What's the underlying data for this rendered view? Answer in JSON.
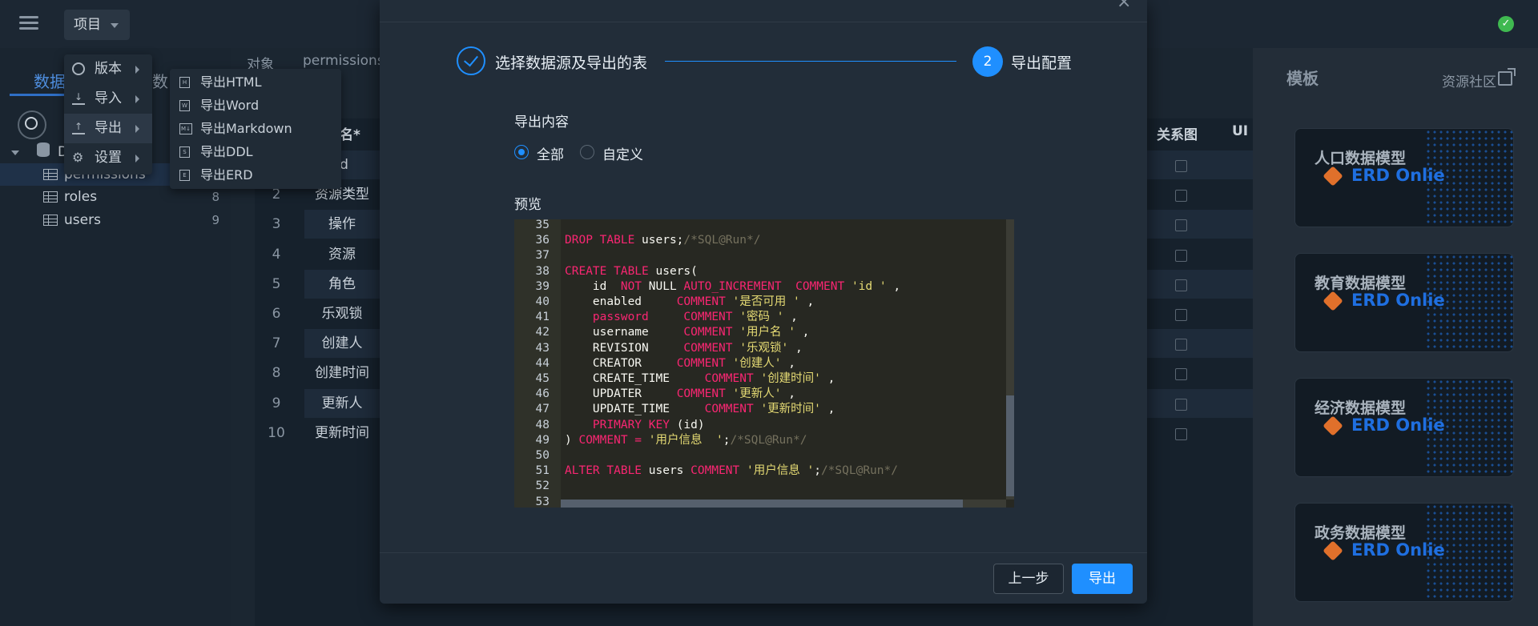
{
  "topbar": {
    "project_label": "项目"
  },
  "left_panel": {
    "tab_data": "数据",
    "tab_second": "数",
    "tree": {
      "db_label": "D",
      "tables": [
        {
          "name": "permissions",
          "count": ""
        },
        {
          "name": "roles",
          "count": "8"
        },
        {
          "name": "users",
          "count": "9"
        }
      ]
    }
  },
  "menu": {
    "items": [
      {
        "label": "版本"
      },
      {
        "label": "导入"
      },
      {
        "label": "导出"
      },
      {
        "label": "设置"
      }
    ],
    "submenu": [
      {
        "label": "导出HTML",
        "icon": "html-file-icon"
      },
      {
        "label": "导出Word",
        "icon": "word-file-icon"
      },
      {
        "label": "导出Markdown",
        "icon": "markdown-icon"
      },
      {
        "label": "导出DDL",
        "icon": "ddl-file-icon"
      },
      {
        "label": "导出ERD",
        "icon": "erd-file-icon"
      }
    ]
  },
  "middle": {
    "tabs": [
      "对象",
      "permissions"
    ],
    "column_header": "名*",
    "col_relation": "关系图",
    "col_ui": "UI",
    "rows": [
      {
        "num": "1",
        "name": "Id"
      },
      {
        "num": "2",
        "name": "资源类型"
      },
      {
        "num": "3",
        "name": "操作"
      },
      {
        "num": "4",
        "name": "资源"
      },
      {
        "num": "5",
        "name": "角色"
      },
      {
        "num": "6",
        "name": "乐观锁"
      },
      {
        "num": "7",
        "name": "创建人"
      },
      {
        "num": "8",
        "name": "创建时间"
      },
      {
        "num": "9",
        "name": "更新人"
      },
      {
        "num": "10",
        "name": "更新时间"
      }
    ]
  },
  "right_panel": {
    "title": "模板",
    "community_link": "资源社区",
    "templates": [
      {
        "title": "人口数据模型",
        "brand": "ERD Onlie"
      },
      {
        "title": "教育数据模型",
        "brand": "ERD Onlie"
      },
      {
        "title": "经济数据模型",
        "brand": "ERD Onlie"
      },
      {
        "title": "政务数据模型",
        "brand": "ERD Onlie"
      }
    ]
  },
  "modal": {
    "step1_label": "选择数据源及导出的表",
    "step2_number": "2",
    "step2_label": "导出配置",
    "export_content_label": "导出内容",
    "radio_all": "全部",
    "radio_custom": "自定义",
    "preview_label": "预览",
    "prev_button": "上一步",
    "export_button": "导出",
    "code_lines": [
      {
        "n": "35",
        "segs": []
      },
      {
        "n": "36",
        "segs": [
          [
            "kw",
            "DROP TABLE "
          ],
          [
            "pl",
            "users;"
          ],
          [
            "cm",
            "/*SQL@Run*/"
          ]
        ]
      },
      {
        "n": "37",
        "segs": []
      },
      {
        "n": "38",
        "segs": [
          [
            "kw",
            "CREATE TABLE "
          ],
          [
            "pl",
            "users("
          ]
        ]
      },
      {
        "n": "39",
        "segs": [
          [
            "pl",
            "    id  "
          ],
          [
            "kw",
            "NOT "
          ],
          [
            "pl",
            "NULL "
          ],
          [
            "kw",
            "AUTO_INCREMENT  COMMENT "
          ],
          [
            "st",
            "'id '"
          ],
          [
            "pl",
            " ,"
          ]
        ]
      },
      {
        "n": "40",
        "segs": [
          [
            "pl",
            "    enabled     "
          ],
          [
            "kw",
            "COMMENT "
          ],
          [
            "st",
            "'是否可用 '"
          ],
          [
            "pl",
            " ,"
          ]
        ]
      },
      {
        "n": "41",
        "segs": [
          [
            "kw",
            "    password     COMMENT "
          ],
          [
            "st",
            "'密码 '"
          ],
          [
            "pl",
            " ,"
          ]
        ]
      },
      {
        "n": "42",
        "segs": [
          [
            "pl",
            "    username     "
          ],
          [
            "kw",
            "COMMENT "
          ],
          [
            "st",
            "'用户名 '"
          ],
          [
            "pl",
            " ,"
          ]
        ]
      },
      {
        "n": "43",
        "segs": [
          [
            "pl",
            "    REVISION     "
          ],
          [
            "kw",
            "COMMENT "
          ],
          [
            "st",
            "'乐观锁'"
          ],
          [
            "pl",
            " ,"
          ]
        ]
      },
      {
        "n": "44",
        "segs": [
          [
            "pl",
            "    CREATOR     "
          ],
          [
            "kw",
            "COMMENT "
          ],
          [
            "st",
            "'创建人'"
          ],
          [
            "pl",
            " ,"
          ]
        ]
      },
      {
        "n": "45",
        "segs": [
          [
            "pl",
            "    CREATE_TIME     "
          ],
          [
            "kw",
            "COMMENT "
          ],
          [
            "st",
            "'创建时间'"
          ],
          [
            "pl",
            " ,"
          ]
        ]
      },
      {
        "n": "46",
        "segs": [
          [
            "pl",
            "    UPDATER     "
          ],
          [
            "kw",
            "COMMENT "
          ],
          [
            "st",
            "'更新人'"
          ],
          [
            "pl",
            " ,"
          ]
        ]
      },
      {
        "n": "47",
        "segs": [
          [
            "pl",
            "    UPDATE_TIME     "
          ],
          [
            "kw",
            "COMMENT "
          ],
          [
            "st",
            "'更新时间'"
          ],
          [
            "pl",
            " ,"
          ]
        ]
      },
      {
        "n": "48",
        "segs": [
          [
            "kw",
            "    PRIMARY KEY "
          ],
          [
            "pl",
            "(id)"
          ]
        ]
      },
      {
        "n": "49",
        "segs": [
          [
            "pl",
            ") "
          ],
          [
            "kw",
            "COMMENT = "
          ],
          [
            "st",
            "'用户信息  '"
          ],
          [
            "pl",
            ";"
          ],
          [
            "cm",
            "/*SQL@Run*/"
          ]
        ]
      },
      {
        "n": "50",
        "segs": []
      },
      {
        "n": "51",
        "segs": [
          [
            "kw",
            "ALTER TABLE "
          ],
          [
            "pl",
            "users "
          ],
          [
            "kw",
            "COMMENT "
          ],
          [
            "st",
            "'用户信息 '"
          ],
          [
            "pl",
            ";"
          ],
          [
            "cm",
            "/*SQL@Run*/"
          ]
        ]
      },
      {
        "n": "52",
        "segs": []
      },
      {
        "n": "53",
        "segs": []
      }
    ]
  },
  "colors": {
    "accent": "#1f8fff",
    "keyword": "#f92672",
    "comment": "#75715e",
    "string": "#e6db74",
    "ok": "#3fb950"
  }
}
